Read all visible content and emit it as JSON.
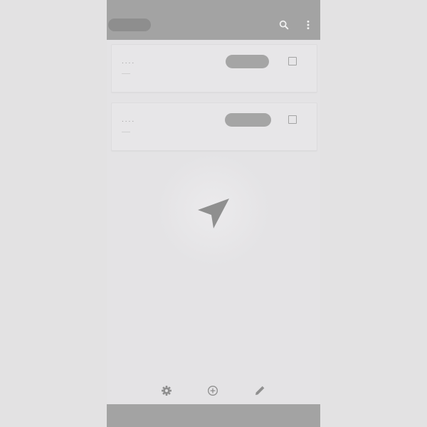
{
  "app": {
    "title": ""
  },
  "toolbar": {
    "icons": [
      "search-icon",
      "more-vert-icon"
    ]
  },
  "cards": [
    {
      "title": "....",
      "subtitle": "",
      "badge": "",
      "checked": false
    },
    {
      "title": "....",
      "subtitle": "",
      "badge": "",
      "checked": false
    }
  ],
  "empty_state": {
    "icon": "navigation-arrow-icon"
  },
  "bottom_toolbar": {
    "icons": [
      "settings-icon",
      "add-circle-icon",
      "edit-icon"
    ]
  },
  "colors": {
    "appbar": "#a3a3a3",
    "background": "#e4e3e5",
    "card": "#e7e6e8",
    "pill": "#a5a5a5",
    "icon": "#8f8f8f"
  }
}
